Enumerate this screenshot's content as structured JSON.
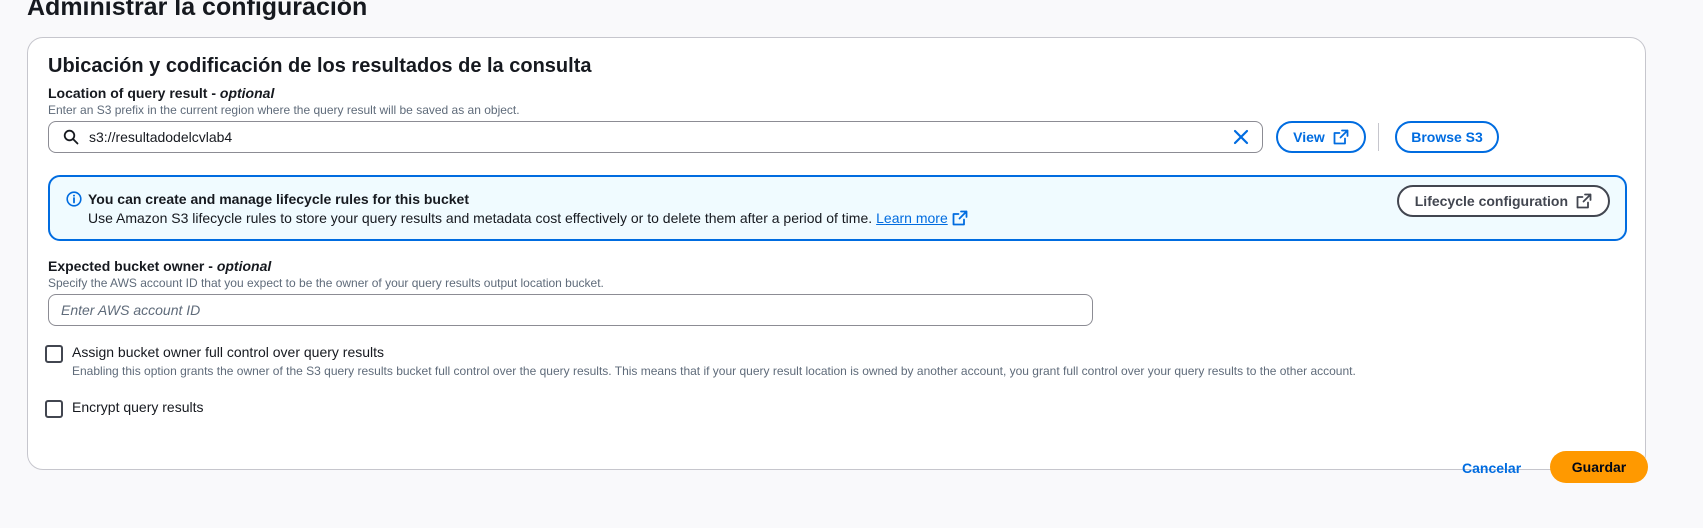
{
  "page": {
    "title": "Administrar la configuración"
  },
  "section": {
    "title": "Ubicación y codificación de los resultados de la consulta"
  },
  "query_location": {
    "label": "Location of query result - ",
    "optional": "optional",
    "description": "Enter an S3 prefix in the current region where the query result will be saved as an object.",
    "value": "s3://resultadodelcvlab4",
    "view_label": "View",
    "browse_label": "Browse S3"
  },
  "lifecycle_alert": {
    "title": "You can create and manage lifecycle rules for this bucket",
    "body": "Use Amazon S3 lifecycle rules to store your query results and metadata cost effectively or to delete them after a period of time.",
    "link_label": "Learn more",
    "button_label": "Lifecycle configuration"
  },
  "bucket_owner": {
    "label": "Expected bucket owner - ",
    "optional": "optional",
    "description": "Specify the AWS account ID that you expect to be the owner of your query results output location bucket.",
    "placeholder": "Enter AWS account ID",
    "value": ""
  },
  "full_control": {
    "label": "Assign bucket owner full control over query results",
    "description": "Enabling this option grants the owner of the S3 query results bucket full control over the query results. This means that if your query result location is owned by another account, you grant full control over your query results to the other account.",
    "checked": false
  },
  "encrypt": {
    "label": "Encrypt query results",
    "checked": false
  },
  "actions": {
    "cancel_label": "Cancelar",
    "save_label": "Guardar"
  },
  "colors": {
    "accent": "#006ce0",
    "primary_button": "#ff9900",
    "info_background": "#f0fbff"
  }
}
